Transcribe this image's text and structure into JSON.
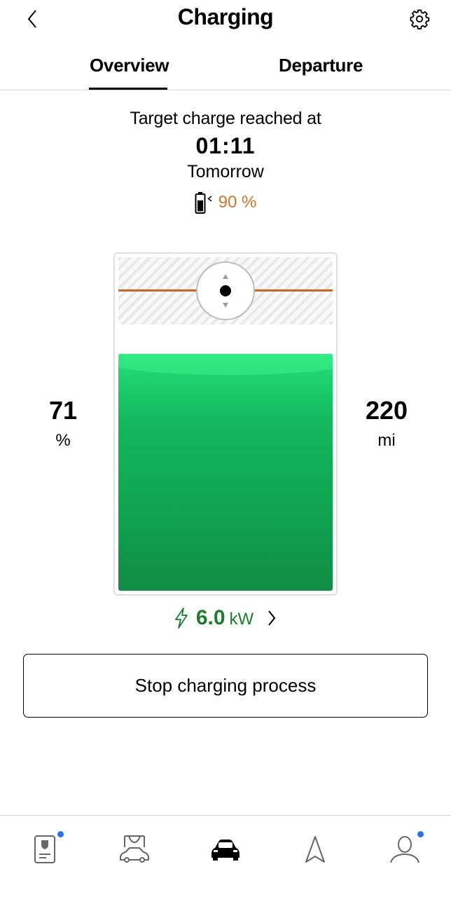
{
  "header": {
    "title": "Charging",
    "back_icon": "chevron-left-icon",
    "settings_icon": "gear-icon"
  },
  "tabs": [
    {
      "label": "Overview",
      "active": true
    },
    {
      "label": "Departure",
      "active": false
    }
  ],
  "summary": {
    "target_label": "Target charge reached at",
    "target_time": "01:11",
    "target_day": "Tomorrow",
    "target_percent": "90 %"
  },
  "state_of_charge": {
    "value": "71",
    "unit": "%"
  },
  "range": {
    "value": "220",
    "unit": "mi"
  },
  "battery": {
    "current_level": 0.71,
    "target_level": 0.9
  },
  "power": {
    "value": "6.0",
    "unit": "kW"
  },
  "actions": {
    "stop_label": "Stop charging process"
  },
  "bottom_nav": [
    {
      "icon": "vehicle-pass-icon",
      "notification": true
    },
    {
      "icon": "car-garage-icon",
      "notification": false
    },
    {
      "icon": "car-icon",
      "notification": false,
      "active": true
    },
    {
      "icon": "navigation-icon",
      "notification": false
    },
    {
      "icon": "profile-icon",
      "notification": true
    }
  ],
  "colors": {
    "accent_orange": "#c9752a",
    "charge_green": "#14b75b",
    "power_green": "#1d7d2c",
    "notification_blue": "#2f6fe0"
  }
}
